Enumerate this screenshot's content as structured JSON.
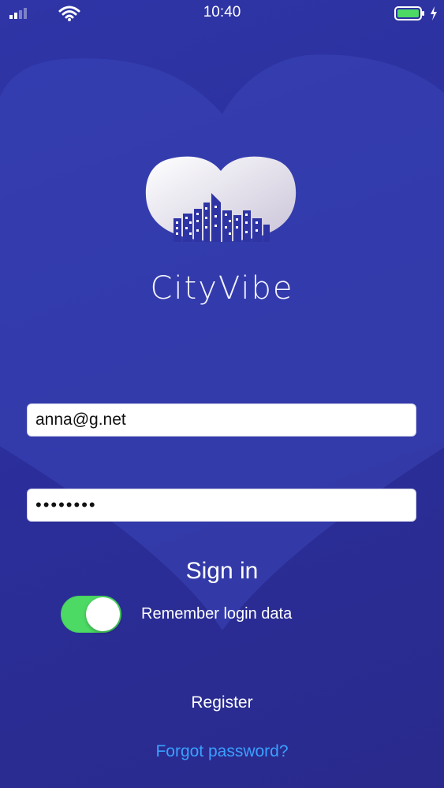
{
  "status_bar": {
    "time": "10:40",
    "battery_level": 1.0,
    "charging": true
  },
  "app": {
    "name": "CityVibe"
  },
  "login": {
    "email_value": "anna@g.net",
    "password_value": "••••••••",
    "sign_in_label": "Sign in",
    "remember_label": "Remember login data",
    "remember_on": true,
    "register_label": "Register",
    "forgot_label": "Forgot password?"
  },
  "colors": {
    "background": "#2b2f9c",
    "toggle_on": "#4cd964",
    "link": "#3aa0ff",
    "battery": "#4cd964"
  }
}
